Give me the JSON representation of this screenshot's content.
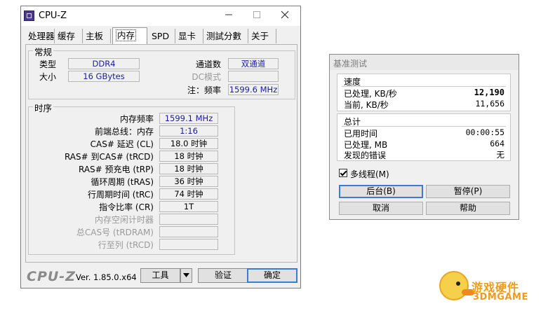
{
  "cpuz": {
    "title": "CPU-Z",
    "tabs": [
      "处理器",
      "缓存",
      "主板",
      "内存",
      "SPD",
      "显卡",
      "测試分數",
      "关于"
    ],
    "active_tab": "内存",
    "general": {
      "group_title": "常规",
      "type_label": "类型",
      "type_value": "DDR4",
      "size_label": "大小",
      "size_value": "16 GBytes",
      "channels_label": "通道数",
      "channels_value": "双通道",
      "dc_label": "DC模式",
      "dc_value": "",
      "freq_label": "注：频率",
      "freq_value": "1599.6 MHz"
    },
    "timings": {
      "group_title": "时序",
      "rows": [
        {
          "label": "内存频率",
          "value": "1599.1 MHz",
          "dark": false
        },
        {
          "label": "前端总线：内存",
          "value": "1:16",
          "dark": false
        },
        {
          "label": "CAS# 延迟 (CL)",
          "value": "18.0 时钟",
          "dark": true
        },
        {
          "label": "RAS# 到CAS# (tRCD)",
          "value": "18 时钟",
          "dark": true
        },
        {
          "label": "RAS# 预充电 (tRP)",
          "value": "18 时钟",
          "dark": true
        },
        {
          "label": "循环周期 (tRAS)",
          "value": "36 时钟",
          "dark": true
        },
        {
          "label": "行周期时间 (tRC)",
          "value": "74 时钟",
          "dark": true
        },
        {
          "label": "指令比率 (CR)",
          "value": "1T",
          "dark": true
        }
      ],
      "disabled_rows": [
        {
          "label": "内存空闲计时器",
          "value": ""
        },
        {
          "label": "总CAS号 (tRDRAM)",
          "value": ""
        },
        {
          "label": "行至列 (tRCD)",
          "value": ""
        }
      ]
    },
    "bottom": {
      "logo": "CPU-Z",
      "version": "Ver. 1.85.0.x64",
      "tools_label": "工具",
      "validate_label": "验证",
      "ok_label": "确定"
    }
  },
  "bench": {
    "title": "基准测试",
    "speed": {
      "heading": "速度",
      "processed_label": "已处理, KB/秒",
      "processed_value": "12,190",
      "current_label": "当前, KB/秒",
      "current_value": "11,656"
    },
    "total": {
      "heading": "总计",
      "elapsed_label": "已用时间",
      "elapsed_value": "00:00:55",
      "processed_label": "已处理, MB",
      "processed_value": "664",
      "errors_label": "发现的错误",
      "errors_value": "无"
    },
    "multithread_label": "多线程(M)",
    "multithread_checked": true,
    "buttons": {
      "background": "后台(B)",
      "pause": "暂停(P)",
      "cancel": "取消",
      "help": "帮助"
    }
  },
  "watermark": {
    "line1": "游戏硬件",
    "line2": "3DMGAME"
  }
}
